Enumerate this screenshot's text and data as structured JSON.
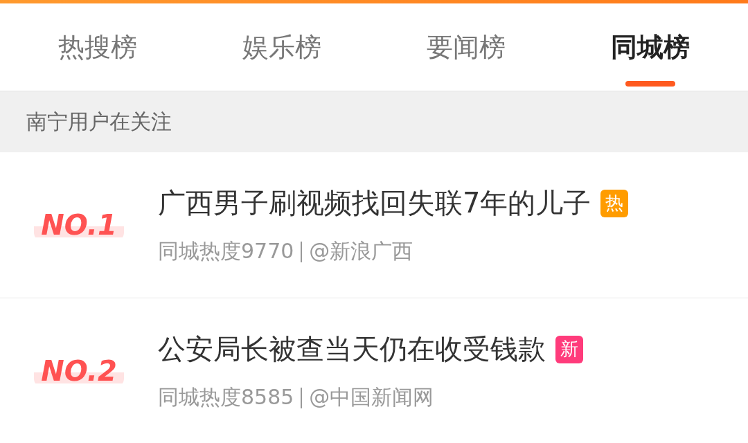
{
  "tabs": [
    {
      "label": "热搜榜",
      "selected": false
    },
    {
      "label": "娱乐榜",
      "selected": false
    },
    {
      "label": "要闻榜",
      "selected": false
    },
    {
      "label": "同城榜",
      "selected": true
    }
  ],
  "section_header": "南宁用户在关注",
  "items": [
    {
      "rank": "NO.1",
      "title": "广西男子刷视频找回失联7年的儿子",
      "tag": {
        "text": "热",
        "color": "#ff9c00"
      },
      "heat": "同城热度9770",
      "source": "@新浪广西"
    },
    {
      "rank": "NO.2",
      "title": "公安局长被查当天仍在收受钱款",
      "tag": {
        "text": "新",
        "color": "#ff3b7b"
      },
      "heat": "同城热度8585",
      "source": "@中国新闻网"
    }
  ]
}
